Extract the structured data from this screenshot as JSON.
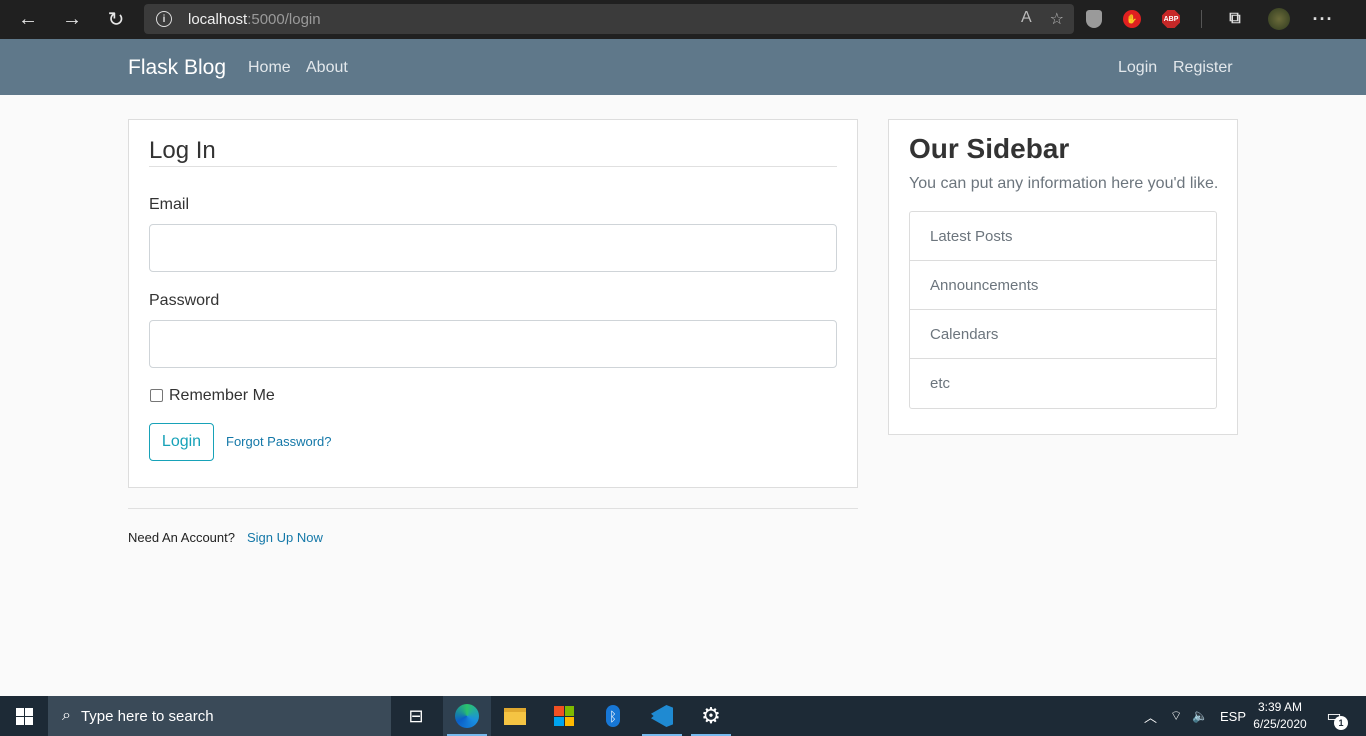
{
  "browser": {
    "url_host": "localhost",
    "url_path": ":5000/login",
    "back_icon": "←",
    "forward_icon": "→",
    "refresh_icon": "↻"
  },
  "navbar": {
    "brand": "Flask Blog",
    "links": [
      "Home",
      "About"
    ],
    "right_links": [
      "Login",
      "Register"
    ]
  },
  "login_form": {
    "legend": "Log In",
    "email_label": "Email",
    "password_label": "Password",
    "remember_label": "Remember Me",
    "submit_label": "Login",
    "forgot_link": "Forgot Password?",
    "accent_color": "#17a2b8"
  },
  "footer": {
    "need_account": "Need An Account?",
    "sign_up": "Sign Up Now"
  },
  "sidebar": {
    "title": "Our Sidebar",
    "text": "You can put any information here you'd like.",
    "items": [
      "Latest Posts",
      "Announcements",
      "Calendars",
      "etc"
    ]
  },
  "taskbar": {
    "search_placeholder": "Type here to search",
    "language": "ESP",
    "time": "3:39 AM",
    "date": "6/25/2020",
    "notification_count": "1"
  }
}
